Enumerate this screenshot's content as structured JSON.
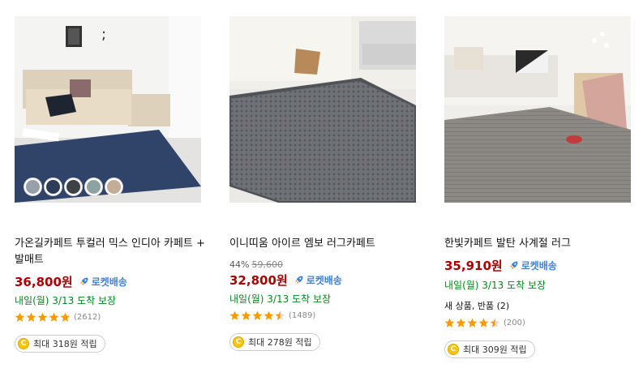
{
  "products": [
    {
      "title": "가온길카페트 투컬러 믹스 인디아 카페트 + 발매트",
      "price": "36,800원",
      "rocket_label": "로켓배송",
      "delivery": "내일(월) 3/13 도착 보장",
      "rating": 5,
      "review_count": "(2612)",
      "cash_label": "최대 318원 적립",
      "swatch_colors": [
        "#9aa0a8",
        "#2e3d57",
        "#3e4246",
        "#8ea3a0",
        "#c3ac98"
      ]
    },
    {
      "title": "이니띠움 아이르 엠보 러그카페트",
      "discount_rate": "44%",
      "original_price": "59,600",
      "price": "32,800원",
      "rocket_label": "로켓배송",
      "delivery": "내일(월) 3/13 도착 보장",
      "rating": 4.5,
      "review_count": "(1489)",
      "cash_label": "최대 278원 적립"
    },
    {
      "title": "한빛카페트 발탄 사계절 러그",
      "price": "35,910원",
      "rocket_label": "로켓배송",
      "delivery": "내일(월) 3/13 도착 보장",
      "extra": "새 상품, 반품 (2)",
      "rating": 4.5,
      "review_count": "(200)",
      "cash_label": "최대 309원 적립"
    }
  ],
  "colors": {
    "price": "#ae0000",
    "rocket": "#3d81d9",
    "delivery": "#00891a",
    "star": "#f69b00",
    "coin": "#f6c513"
  },
  "icons": {
    "rocket": "rocket-icon",
    "star": "star-icon",
    "coin": "coin-icon"
  },
  "coin_symbol": "C"
}
